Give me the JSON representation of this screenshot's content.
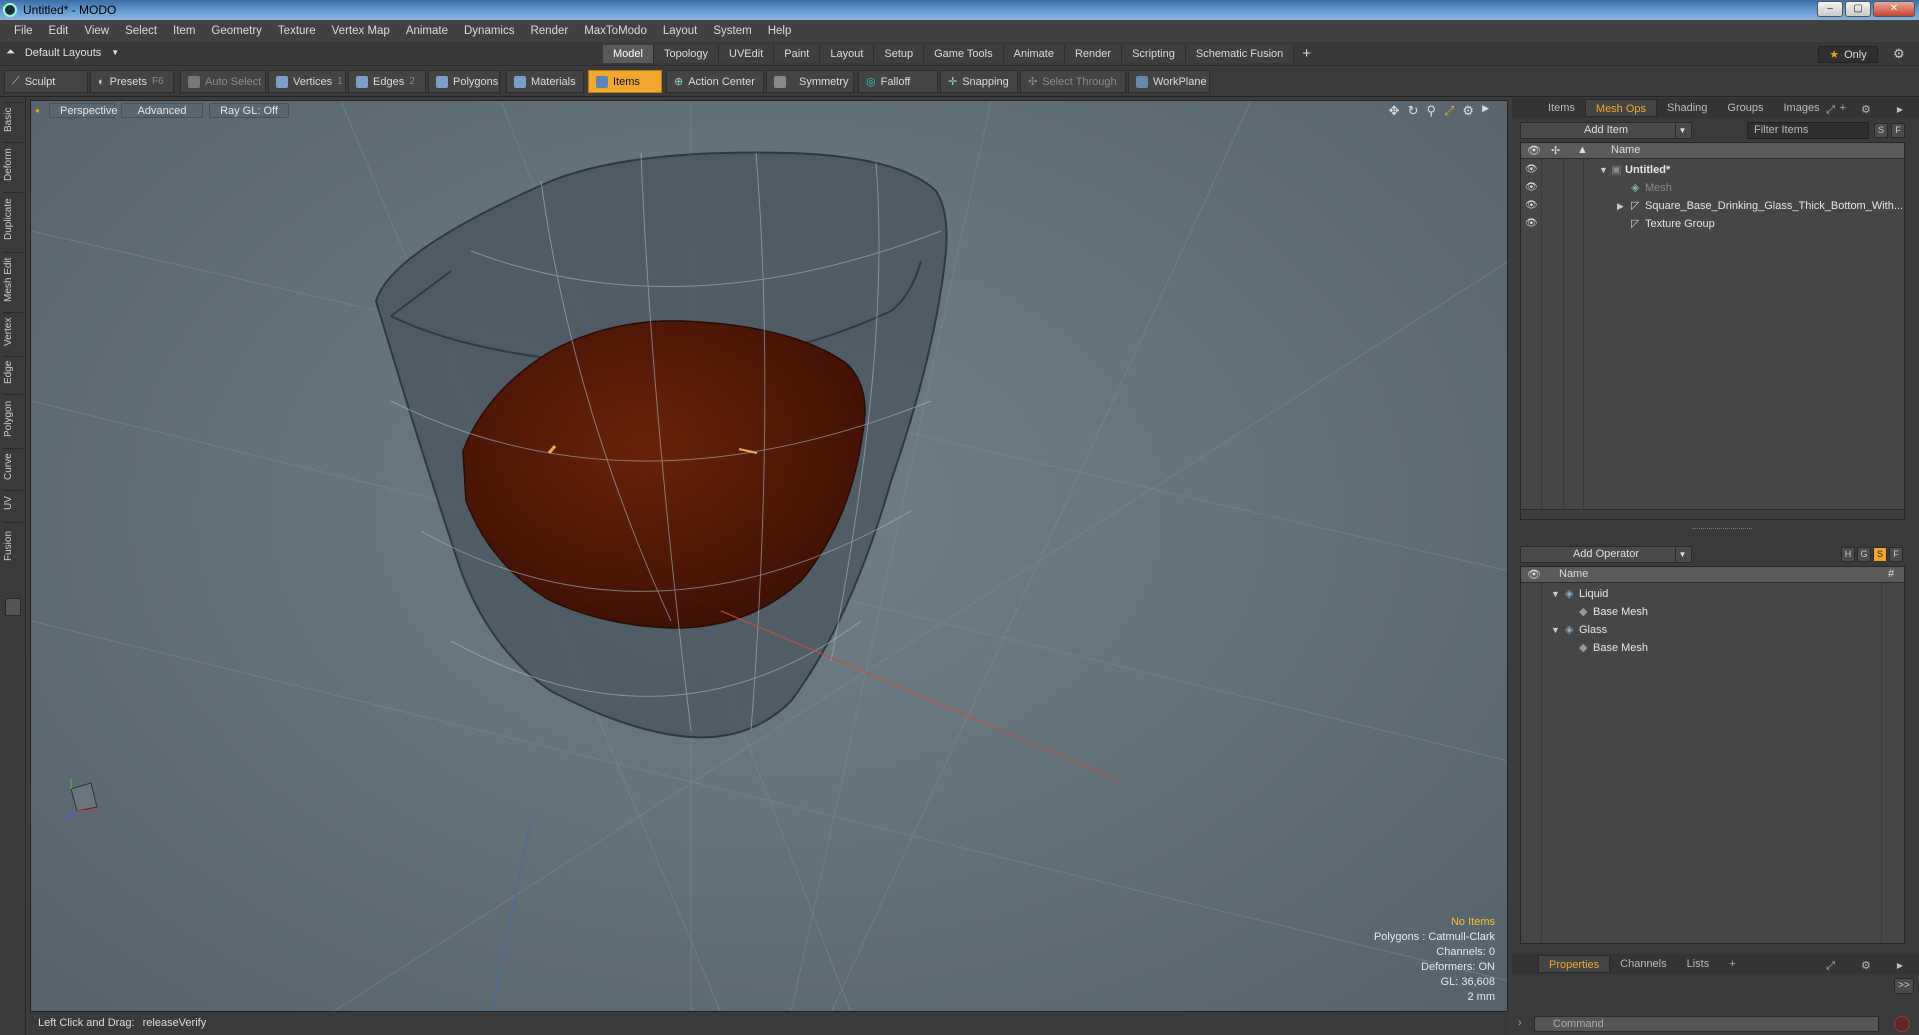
{
  "window": {
    "title": "Untitled* - MODO"
  },
  "menu": [
    "File",
    "Edit",
    "View",
    "Select",
    "Item",
    "Geometry",
    "Texture",
    "Vertex Map",
    "Animate",
    "Dynamics",
    "Render",
    "MaxToModo",
    "Layout",
    "System",
    "Help"
  ],
  "layout_selector": "Default Layouts",
  "layout_tabs": [
    "Model",
    "Topology",
    "UVEdit",
    "Paint",
    "Layout",
    "Setup",
    "Game Tools",
    "Animate",
    "Render",
    "Scripting",
    "Schematic Fusion"
  ],
  "layout_tabs_active": "Model",
  "only_label": "Only",
  "toolbar": {
    "sculpt": "Sculpt",
    "presets": "Presets",
    "presets_key": "F6",
    "auto_select": "Auto Select",
    "vertices": "Vertices",
    "vertices_key": "1",
    "edges": "Edges",
    "edges_key": "2",
    "polygons": "Polygons",
    "materials": "Materials",
    "items": "Items",
    "action_center": "Action Center",
    "symmetry": "Symmetry",
    "falloff": "Falloff",
    "snapping": "Snapping",
    "select_through": "Select Through",
    "workplane": "WorkPlane"
  },
  "left_tabs": [
    "Basic",
    "Deform",
    "Duplicate",
    "Mesh Edit",
    "Vertex",
    "Edge",
    "Polygon",
    "Curve",
    "UV",
    "Fusion"
  ],
  "viewport": {
    "view": "Perspective",
    "mode": "Advanced",
    "raygl": "Ray GL: Off",
    "info": {
      "items": "No Items",
      "polygons": "Polygons : Catmull-Clark",
      "channels": "Channels: 0",
      "deformers": "Deformers: ON",
      "gl": "GL: 36,608",
      "unit": "2 mm"
    }
  },
  "status": {
    "label": "Left Click and Drag:",
    "value": "releaseVerify"
  },
  "items_panel": {
    "tabs": [
      "Items",
      "Mesh Ops",
      "Shading",
      "Groups",
      "Images"
    ],
    "active_tab": "Mesh Ops",
    "add_item": "Add Item",
    "filter_placeholder": "Filter Items",
    "btn_s": "S",
    "btn_f": "F",
    "col_name": "Name",
    "rows": [
      "Untitled*",
      "Mesh",
      "Square_Base_Drinking_Glass_Thick_Bottom_With...",
      "Texture Group"
    ]
  },
  "meshops_panel": {
    "add_operator": "Add Operator",
    "btns": [
      "H",
      "G",
      "S",
      "F"
    ],
    "col_name": "Name",
    "col_hash": "#",
    "rows": [
      "Liquid",
      "Base Mesh",
      "Glass",
      "Base Mesh"
    ]
  },
  "bottom_panel": {
    "tabs": [
      "Properties",
      "Channels",
      "Lists"
    ],
    "active_tab": "Properties",
    "expand": ">>"
  },
  "command": {
    "placeholder": "Command"
  },
  "colors": {
    "accent": "#f0a830",
    "liquid": "#5a1a08",
    "glass": "#4a5560"
  }
}
